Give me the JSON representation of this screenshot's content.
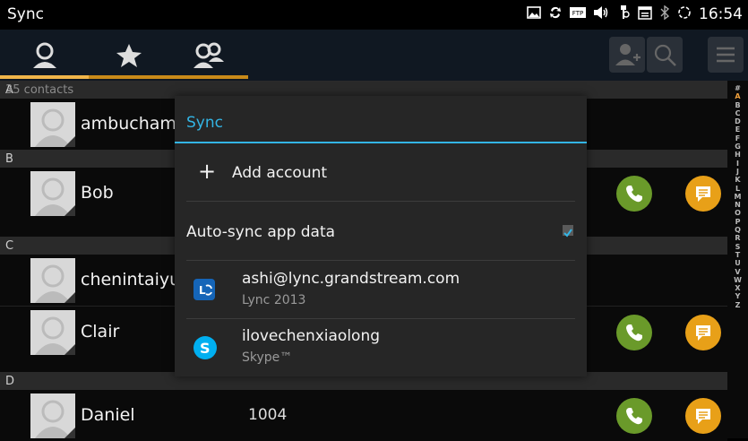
{
  "status_bar": {
    "title": "Sync",
    "time": "16:54",
    "icons": [
      "picture-icon",
      "sync-icon",
      "ftp-icon",
      "volume-icon",
      "usb-icon",
      "calendar-icon",
      "bluetooth-icon",
      "wifi-loading-icon"
    ],
    "ftp_label": "FTP"
  },
  "toolbar": {
    "tabs": [
      "contacts-tab",
      "favorites-tab",
      "groups-tab"
    ],
    "actions": [
      "add-contact-button",
      "search-button",
      "menu-button"
    ],
    "accent": "#f0b54a"
  },
  "contacts": {
    "count_label": "35 contacts",
    "sections": [
      {
        "letter": "A",
        "rows": [
          {
            "name": "ambucham",
            "number": ""
          }
        ]
      },
      {
        "letter": "B",
        "rows": [
          {
            "name": "Bob",
            "number": ""
          }
        ]
      },
      {
        "letter": "C",
        "rows": [
          {
            "name": "chenintaiyu",
            "number": ""
          },
          {
            "name": "Clair",
            "number": ""
          }
        ]
      },
      {
        "letter": "D",
        "rows": [
          {
            "name": "Daniel",
            "number": "1004"
          }
        ]
      }
    ]
  },
  "index_letters": [
    "#",
    "A",
    "B",
    "C",
    "D",
    "E",
    "F",
    "G",
    "H",
    "I",
    "J",
    "K",
    "L",
    "M",
    "N",
    "O",
    "P",
    "Q",
    "R",
    "S",
    "T",
    "U",
    "V",
    "W",
    "X",
    "Y",
    "Z"
  ],
  "dialog": {
    "title": "Sync",
    "add_account": "Add account",
    "auto_sync": "Auto-sync app data",
    "auto_sync_checked": true,
    "accounts": [
      {
        "email": "ashi@lync.grandstream.com",
        "type": "Lync 2013",
        "icon": "lync-icon",
        "icon_label": "L"
      },
      {
        "email": "ilovechenxiaolong",
        "type": "Skype™",
        "icon": "skype-icon",
        "icon_label": "S"
      }
    ],
    "accent_color": "#33b5e5"
  }
}
